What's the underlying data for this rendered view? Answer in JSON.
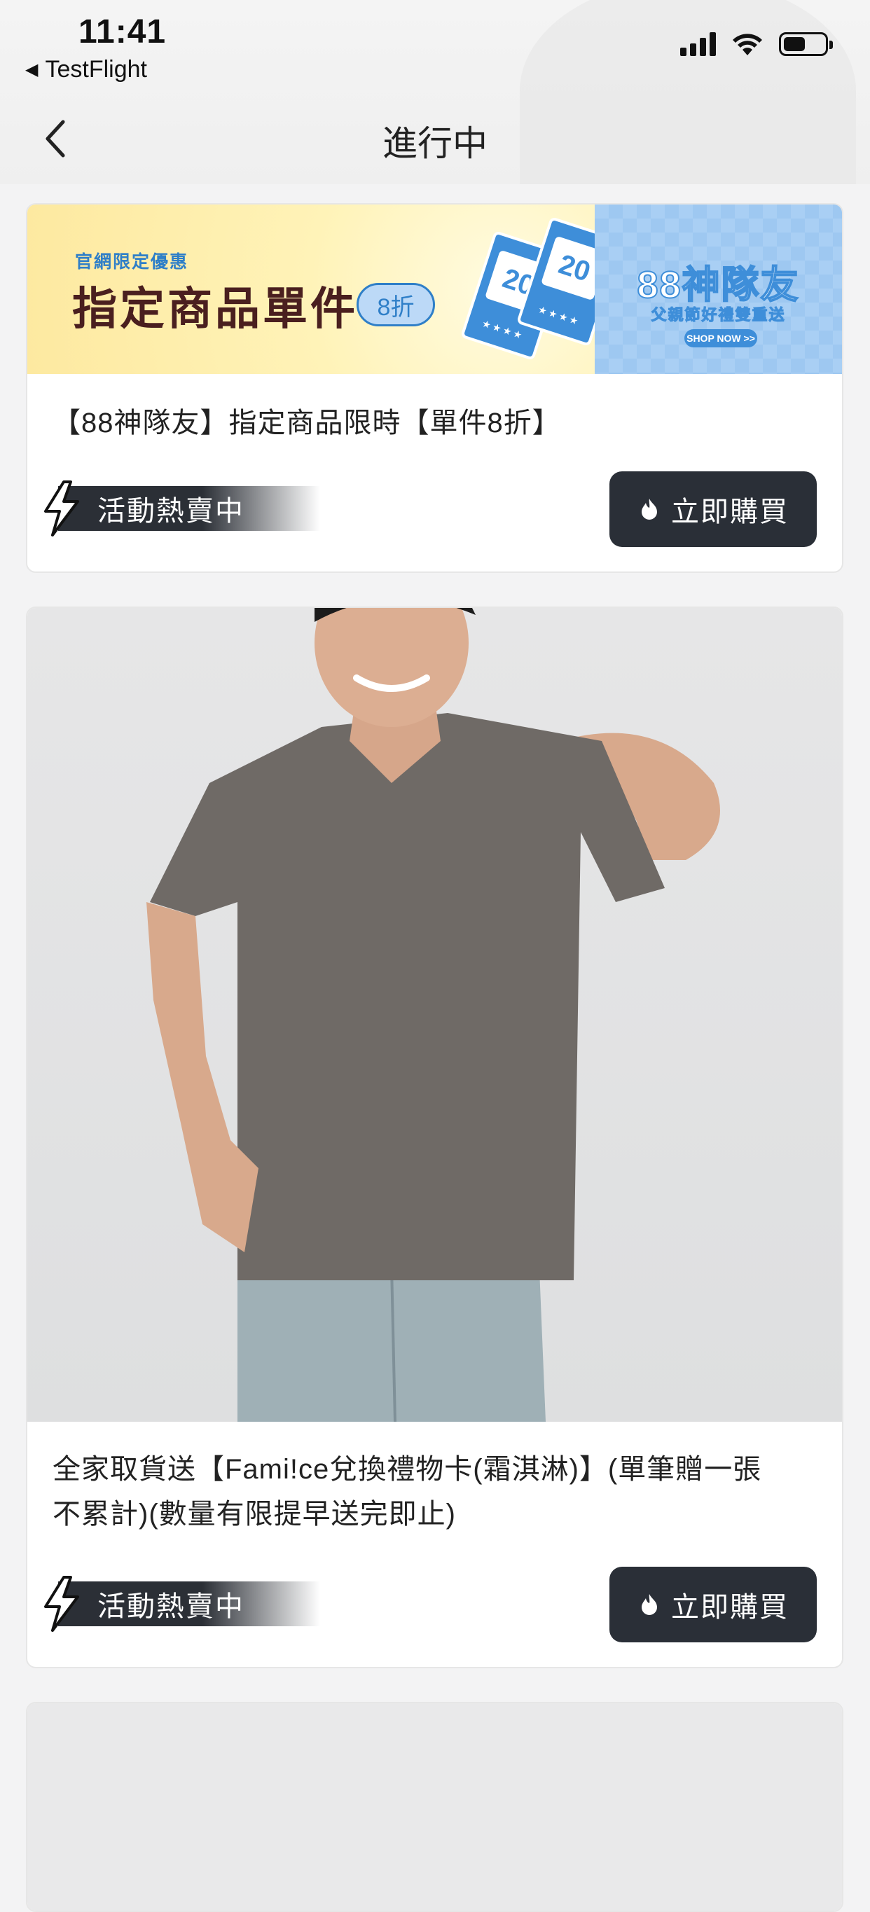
{
  "status_bar": {
    "time": "11:41",
    "back_app": "TestFlight"
  },
  "navbar": {
    "title": "進行中",
    "back_icon": "chevron-left-icon"
  },
  "cards": [
    {
      "banner": {
        "small_text": "官網限定優惠",
        "big_text": "指定商品單件",
        "pill_text": "8折",
        "ticket_number": "20",
        "right_title": "88神隊友",
        "right_subtitle": "父親節好禮雙重送",
        "right_button": "SHOP NOW >>"
      },
      "title": "【88神隊友】指定商品限時【單件8折】",
      "badge": "活動熱賣中",
      "button": "立即購買"
    },
    {
      "title_line1": "全家取貨送【Fami!ce兌換禮物卡(霜淇淋)】(單筆贈一張",
      "title_line2": "不累計)(數量有限提早送完即止)",
      "badge": "活動熱賣中",
      "button": "立即購買"
    }
  ],
  "colors": {
    "button_bg": "#2a2f37",
    "page_bg": "#f3f3f4",
    "banner_blue": "#3e8ed9",
    "banner_yellow": "#fff3b8"
  }
}
